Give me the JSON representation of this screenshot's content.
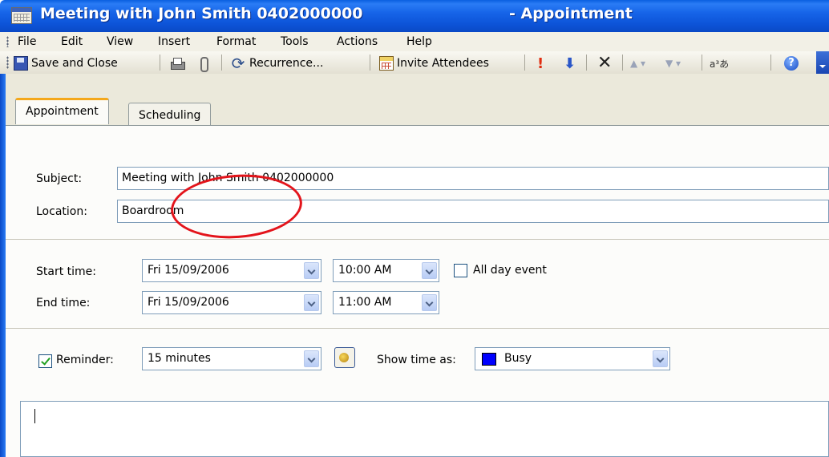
{
  "window": {
    "title": "Meeting with John Smith 0402000000",
    "title_suffix": "- Appointment",
    "icon": "calendar-icon"
  },
  "menu": [
    "File",
    "Edit",
    "View",
    "Insert",
    "Format",
    "Tools",
    "Actions",
    "Help"
  ],
  "toolbar": {
    "save_close": "Save and Close",
    "recurrence": "Recurrence...",
    "invite": "Invite Attendees",
    "translate_glyph": "a³あ",
    "help_glyph": "?"
  },
  "tabs": {
    "appointment": "Appointment",
    "scheduling": "Scheduling"
  },
  "form": {
    "subject_label": "Subject:",
    "subject_value": "Meeting with John Smith 0402000000",
    "location_label": "Location:",
    "location_value": "Boardroom",
    "start_label": "Start time:",
    "start_date": "Fri 15/09/2006",
    "start_time": "10:00 AM",
    "end_label": "End time:",
    "end_date": "Fri 15/09/2006",
    "end_time": "11:00 AM",
    "all_day_label": "All day event",
    "all_day_checked": false,
    "reminder_label": "Reminder:",
    "reminder_checked": true,
    "reminder_value": "15 minutes",
    "show_time_label": "Show time as:",
    "show_time_value": "Busy",
    "busy_color": "#0000ff"
  },
  "colors": {
    "titlebar": "#0d54d8",
    "highlight_circle": "#e3141b",
    "active_tab_accent": "#f4a81c"
  }
}
